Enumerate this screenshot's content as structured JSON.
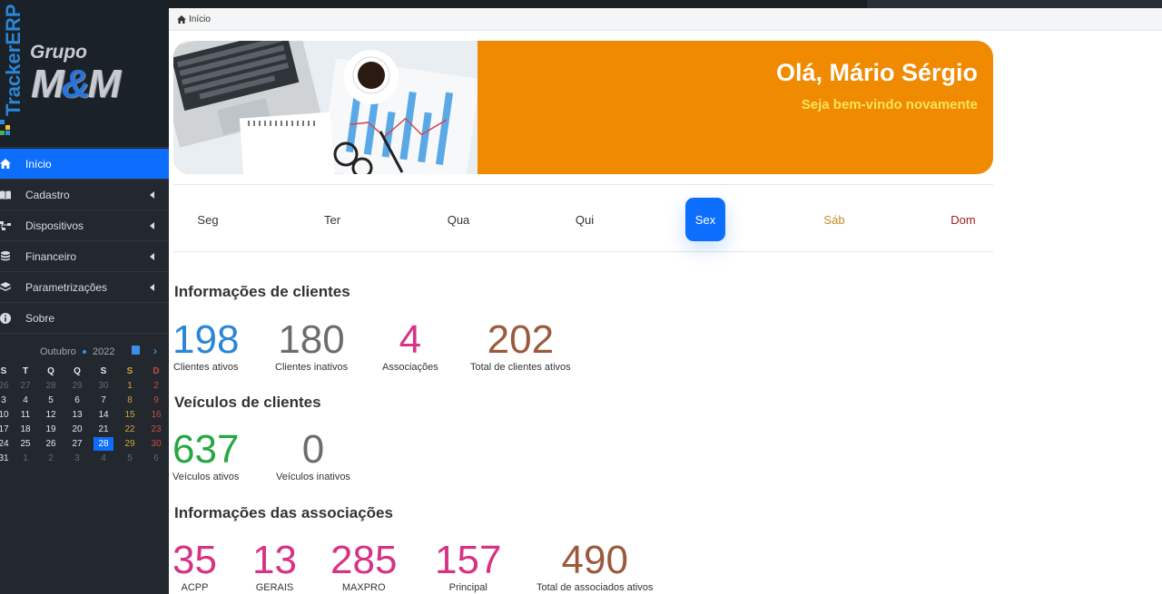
{
  "colors": {
    "primary": "#0d6efd",
    "banner_orange": "#f08a00",
    "sidebar_bg": "#22282e",
    "blue_stat": "#2a86d6",
    "gray_stat": "#6c6c6c",
    "pink_stat": "#d63384",
    "brown_stat": "#9b5a3c",
    "green_stat": "#28a745"
  },
  "sidebar": {
    "brand_vertical": "TrackerERP",
    "logo_top": "Grupo",
    "logo_main_left": "M",
    "logo_main_amp": "&",
    "logo_main_right": "M",
    "items": [
      {
        "label": "Início",
        "icon": "home-icon",
        "active": true
      },
      {
        "label": "Cadastro",
        "icon": "book-icon"
      },
      {
        "label": "Dispositivos",
        "icon": "sitemap-icon"
      },
      {
        "label": "Financeiro",
        "icon": "coins-icon"
      },
      {
        "label": "Parametrizações",
        "icon": "layers-icon"
      },
      {
        "label": "Sobre",
        "icon": "info-icon"
      }
    ]
  },
  "calendar": {
    "month": "Outubro",
    "year": "2022",
    "weekdays": [
      "S",
      "T",
      "Q",
      "Q",
      "S",
      "S",
      "D"
    ],
    "weeks": [
      [
        "26",
        "27",
        "28",
        "29",
        "30",
        "1",
        "2"
      ],
      [
        "3",
        "4",
        "5",
        "6",
        "7",
        "8",
        "9"
      ],
      [
        "10",
        "11",
        "12",
        "13",
        "14",
        "15",
        "16"
      ],
      [
        "17",
        "18",
        "19",
        "20",
        "21",
        "22",
        "23"
      ],
      [
        "24",
        "25",
        "26",
        "27",
        "28",
        "29",
        "30"
      ],
      [
        "31",
        "1",
        "2",
        "3",
        "4",
        "5",
        "6"
      ]
    ],
    "today": "28"
  },
  "breadcrumb": {
    "label": "Início"
  },
  "banner": {
    "greeting": "Olá, Mário Sérgio",
    "subtitle": "Seja bem-vindo novamente"
  },
  "days": [
    "Seg",
    "Ter",
    "Qua",
    "Qui",
    "Sex",
    "Sáb",
    "Dom"
  ],
  "active_day": "Sex",
  "sections": {
    "clientes": {
      "title": "Informações de clientes",
      "stats": [
        {
          "value": "198",
          "label": "Clientes ativos"
        },
        {
          "value": "180",
          "label": "Clientes inativos"
        },
        {
          "value": "4",
          "label": "Associações"
        },
        {
          "value": "202",
          "label": "Total de clientes ativos"
        }
      ]
    },
    "veiculos": {
      "title": "Veículos de clientes",
      "stats": [
        {
          "value": "637",
          "label": "Veículos ativos"
        },
        {
          "value": "0",
          "label": "Veículos inativos"
        }
      ]
    },
    "associacoes": {
      "title": "Informações das associações",
      "stats": [
        {
          "value": "35",
          "label": "ACPP"
        },
        {
          "value": "13",
          "label": "GERAIS"
        },
        {
          "value": "285",
          "label": "MAXPRO"
        },
        {
          "value": "157",
          "label": "Principal"
        },
        {
          "value": "490",
          "label": "Total de associados ativos"
        }
      ]
    }
  }
}
